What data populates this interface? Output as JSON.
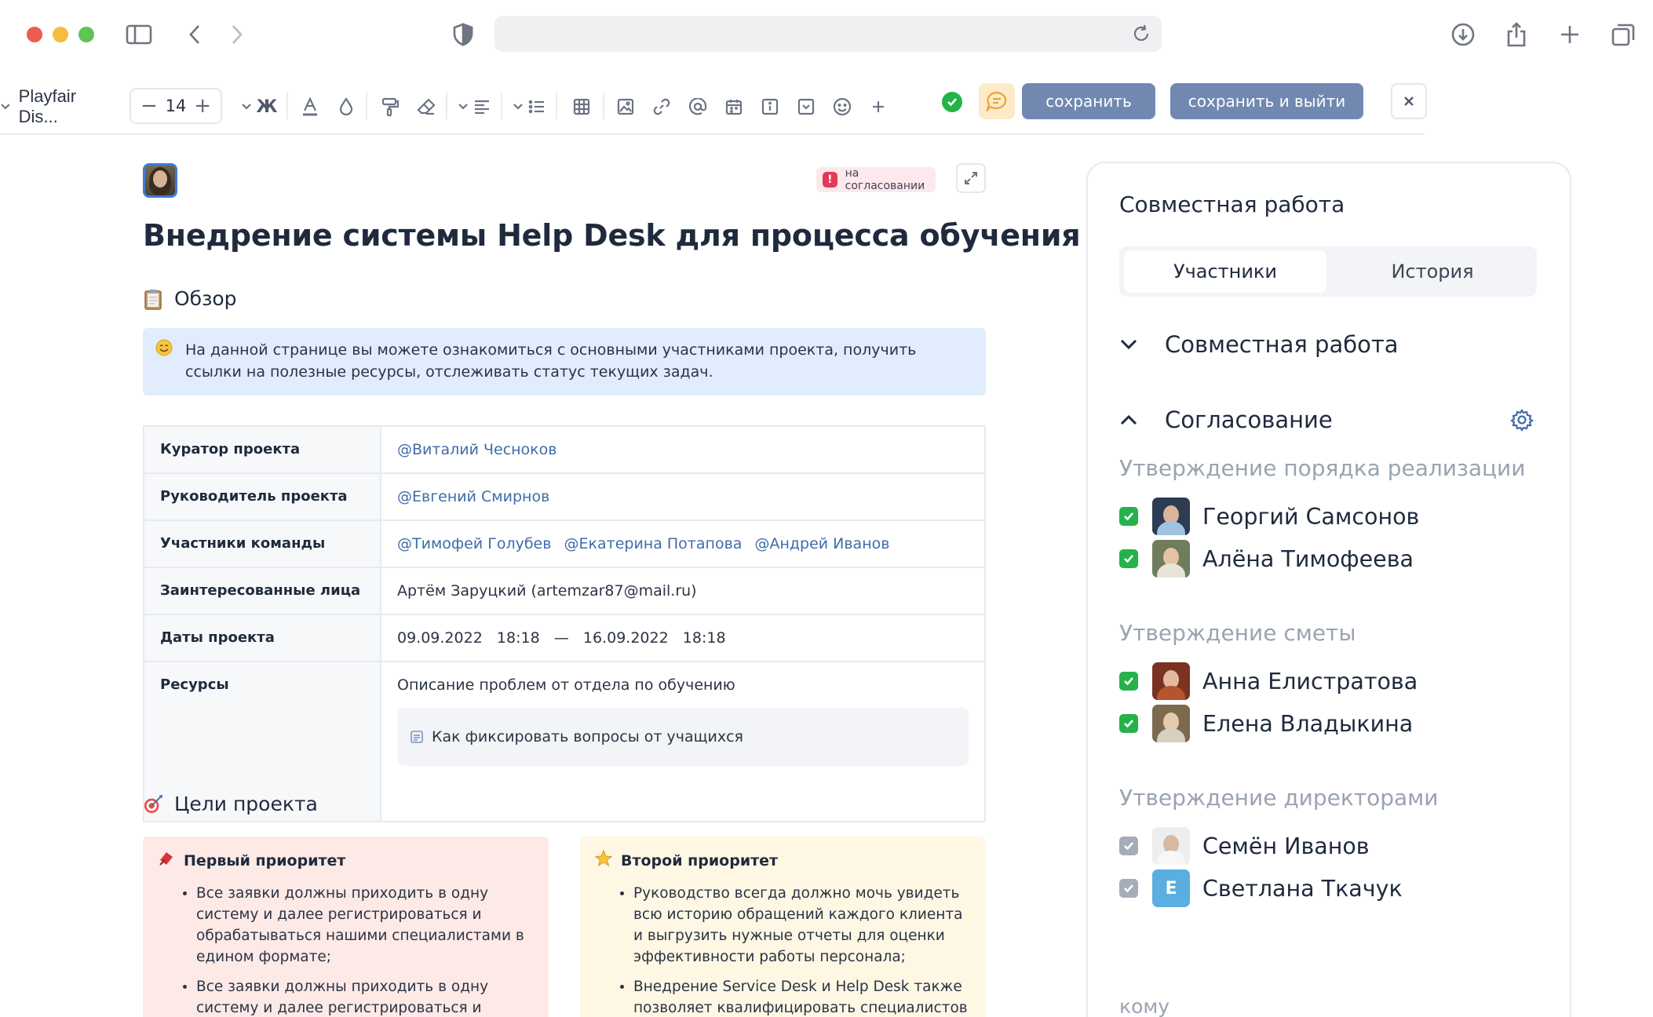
{
  "toolbar": {
    "font_family": "Playfair Dis...",
    "font_size": "14",
    "bold_label": "Ж",
    "save_label": "сохранить",
    "save_exit_label": "сохранить и выйти"
  },
  "document": {
    "status": "на согласовании",
    "title": "Внедрение системы Help Desk для процесса обучения",
    "overview_heading": "Обзор",
    "callout_text": "На данной странице вы можете ознакомиться с основными участниками проекта, получить ссылки на полезные ресурсы, отслеживать статус текущих задач.",
    "table": {
      "curator_label": "Куратор проекта",
      "curator": "@Виталий Чесноков",
      "manager_label": "Руководитель проекта",
      "manager": "@Евгений Смирнов",
      "team_label": "Участники команды",
      "team": [
        "@Тимофей Голубев",
        "@Екатерина Потапова",
        "@Андрей Иванов"
      ],
      "stakeholders_label": "Заинтересованные лица",
      "stakeholders": "Артём Заруцкий (artemzar87@mail.ru)",
      "dates_label": "Даты проекта",
      "dates": "09.09.2022   18:18   —   16.09.2022   18:18",
      "resources_label": "Ресурсы",
      "resources_text": "Описание проблем от отдела по обучению",
      "resource_link": "Как фиксировать вопросы от учащихся"
    },
    "goals_heading": "Цели проекта",
    "goal1": {
      "title": "Первый приоритет",
      "items": [
        "Все заявки должны приходить в одну систему и далее регистрироваться и обрабатываться нашими специалистами в едином формате;",
        "Все заявки должны приходить в одну систему и далее регистрироваться и обрабатываться нашими специалистами в едином формате"
      ]
    },
    "goal2": {
      "title": "Второй приоритет",
      "items": [
        "Руководство всегда должно мочь увидеть всю историю обращений каждого клиента и выгрузить нужные отчеты для оценки эффективности работы персонала;",
        "Внедрение Service Desk и Help Desk также позволяет квалифицировать специалистов IT"
      ]
    }
  },
  "panel": {
    "title": "Совместная работа",
    "tab_participants": "Участники",
    "tab_history": "История",
    "section_collab": "Совместная работа",
    "section_approval": "Согласование",
    "stages": [
      {
        "title": "Утверждение порядка реализации",
        "people": [
          "Георгий Самсонов",
          "Алёна Тимофеева"
        ]
      },
      {
        "title": "Утверждение сметы",
        "people": [
          "Анна Елистратова",
          "Елена Владыкина"
        ]
      },
      {
        "title": "Утверждение директорами",
        "people": [
          "Семён Иванов",
          "Светлана Ткачук"
        ]
      }
    ],
    "avatar_letter": "Е",
    "to_label": "кому"
  },
  "colors": {
    "accent_button": "#7189b1",
    "check_green": "#25b24a",
    "badge_red": "#e23a5a",
    "callout_blue": "#e1edfc",
    "goal1_bg": "#fde9e6",
    "goal2_bg": "#fef7e4"
  }
}
